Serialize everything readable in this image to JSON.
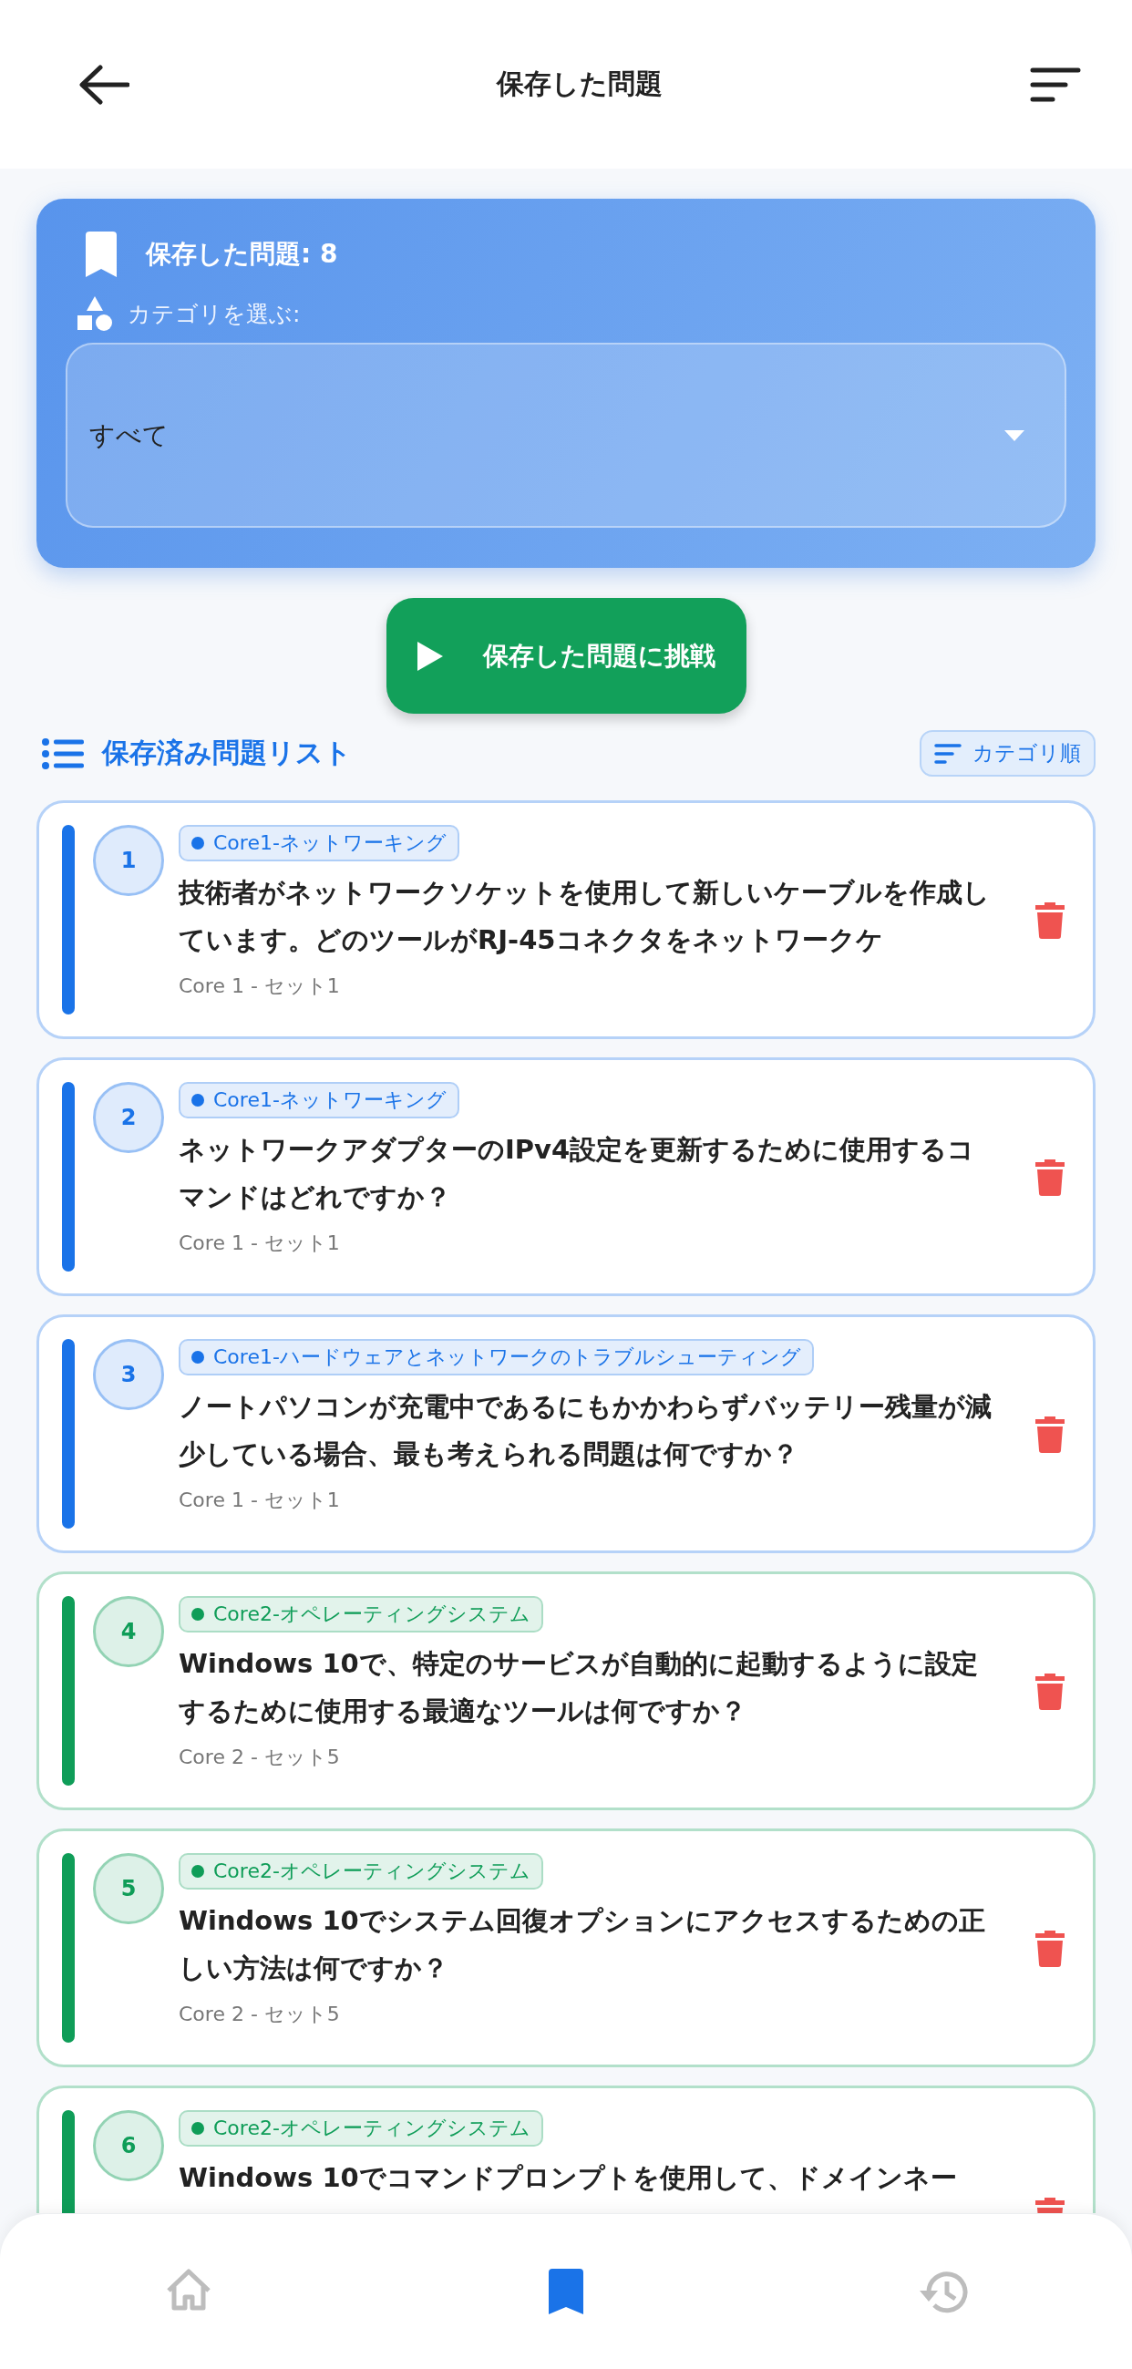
{
  "header": {
    "title": "保存した問題"
  },
  "summary": {
    "title": "保存した問題: 8",
    "category_label": "カテゴリを選ぶ:",
    "category_select": {
      "value": "すべて"
    }
  },
  "challenge_button": "保存した問題に挑戦",
  "list": {
    "title": "保存済み問題リスト",
    "sort_button": "カテゴリ順",
    "items": [
      {
        "number": "1",
        "category": "Core1-ネットワーキング",
        "color": "#1a73e8",
        "question": "技術者がネットワークソケットを使用して新しいケーブルを作成しています。どのツールがRJ-45コネクタをネットワークケ",
        "source": "Core 1 - セット1"
      },
      {
        "number": "2",
        "category": "Core1-ネットワーキング",
        "color": "#1a73e8",
        "question": "ネットワークアダプターのIPv4設定を更新するために使用するコマンドはどれですか？",
        "source": "Core 1 - セット1"
      },
      {
        "number": "3",
        "category": "Core1-ハードウェアとネットワークのトラブルシューティング",
        "color": "#1a73e8",
        "question": "ノートパソコンが充電中であるにもかかわらずバッテリー残量が減少している場合、最も考えられる問題は何ですか？",
        "source": "Core 1 - セット1"
      },
      {
        "number": "4",
        "category": "Core2-オペレーティングシステム",
        "color": "#0f9d58",
        "question": "Windows 10で、特定のサービスが自動的に起動するように設定するために使用する最適なツールは何ですか？",
        "source": "Core 2 - セット5"
      },
      {
        "number": "5",
        "category": "Core2-オペレーティングシステム",
        "color": "#0f9d58",
        "question": "Windows 10でシステム回復オプションにアクセスするための正しい方法は何ですか？",
        "source": "Core 2 - セット5"
      },
      {
        "number": "6",
        "category": "Core2-オペレーティングシステム",
        "color": "#0f9d58",
        "question": "Windows 10でコマンドプロンプトを使用して、ドメインネー"
      }
    ]
  },
  "bottom_nav": [
    {
      "kind": "home",
      "selected": false
    },
    {
      "kind": "bookmark",
      "selected": true
    },
    {
      "kind": "history",
      "selected": false
    }
  ]
}
